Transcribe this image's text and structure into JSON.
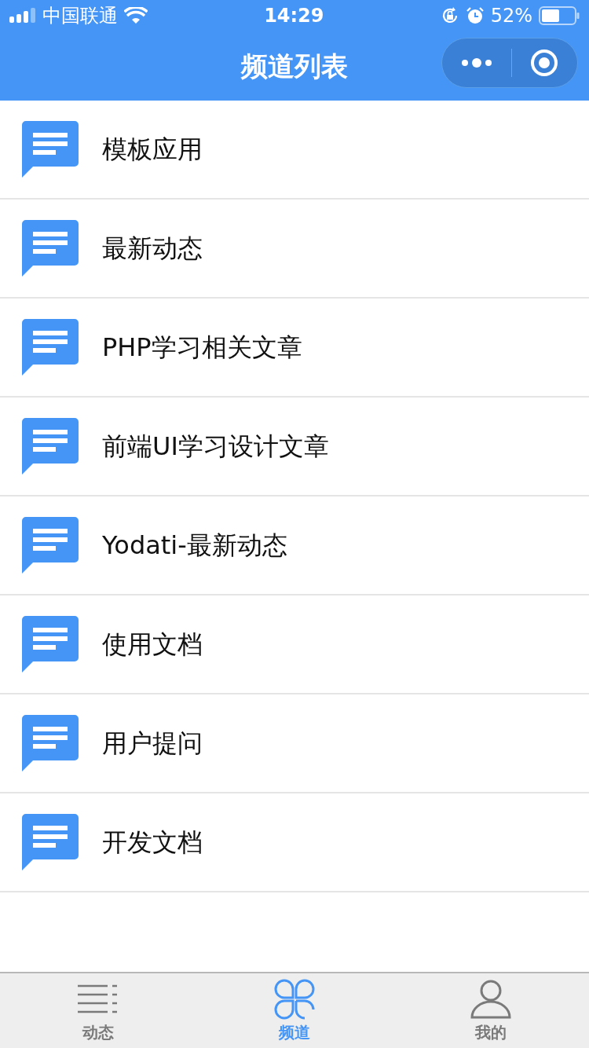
{
  "status_bar": {
    "carrier": "中国联通",
    "time": "14:29",
    "battery_percent": "52%"
  },
  "nav": {
    "title": "频道列表"
  },
  "channels": [
    {
      "title": "模板应用"
    },
    {
      "title": "最新动态"
    },
    {
      "title": "PHP学习相关文章"
    },
    {
      "title": "前端UI学习设计文章"
    },
    {
      "title": "Yodati-最新动态"
    },
    {
      "title": "使用文档"
    },
    {
      "title": "用户提问"
    },
    {
      "title": "开发文档"
    }
  ],
  "tab_bar": [
    {
      "label": "动态",
      "kind": "list",
      "selected": false
    },
    {
      "label": "频道",
      "kind": "clover",
      "selected": true
    },
    {
      "label": "我的",
      "kind": "person",
      "selected": false
    }
  ]
}
